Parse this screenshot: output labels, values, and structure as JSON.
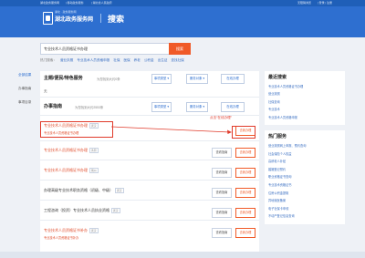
{
  "topbar": {
    "left_links": [
      "湖北政务服务网",
      "| 移动政务服务",
      "| 湖北省人民政府"
    ],
    "right_links": [
      "无障碍浏览",
      "| 登录 | 注册"
    ]
  },
  "header": {
    "logo_org": "湖北 · 政务服务网",
    "logo_title": "湖北政务服务网",
    "search_title": "搜索"
  },
  "search": {
    "value": "专业技术人员资格证书办理",
    "button": "搜索"
  },
  "hotwords": {
    "label": "热门搜索：",
    "items": [
      "营业执照",
      "专业技术人员资格申报",
      "社保",
      "医保",
      "养老",
      "公积金",
      "出生证",
      "查找社保"
    ]
  },
  "sidenav": [
    "全部结果",
    "办事指南",
    "事项目录"
  ],
  "theme_section": {
    "title": "主题/便民/特色服务",
    "meta": "为您找到大约0条",
    "filters": [
      "事项类型",
      "服务对象",
      "在线办理"
    ],
    "empty_text": "无"
  },
  "guide_section": {
    "title": "办事指南",
    "meta": "为您找到大约2553条",
    "filters": [
      "事项类型",
      "服务对象",
      "在线办理"
    ]
  },
  "services": [
    {
      "title": "专业技术人员资格证书办理",
      "tag": "武汉",
      "sub": "专业技术人员资格证书办理",
      "guide": "",
      "go": "去我办理"
    },
    {
      "title": "专业技术人员资格证书办理",
      "tag": "黄冈",
      "sub": "",
      "guide": "查看指南",
      "go": "去我办理"
    },
    {
      "title": "专业技术人员资格证书办理",
      "tag": "荆州",
      "sub": "",
      "guide": "查看指南",
      "go": "去我办理"
    },
    {
      "title": "办理高级专业技术职务资格（初级、中级）",
      "tag": "武汉",
      "sub": "",
      "guide": "查看指南",
      "go": "去我办理"
    },
    {
      "title": "工程咨询（投资）专业技术人员执业资格",
      "tag": "武汉",
      "sub": "",
      "guide": "查看指南",
      "go": "去我办理"
    },
    {
      "title": "专业技术人员资格证书补办",
      "tag": "武汉",
      "sub": "专业技术人员资格证书补办",
      "guide": "查看指南",
      "go": "去我办理"
    }
  ],
  "annotation": "点击“在线办理”",
  "right_panels": {
    "latest": {
      "title": "最近搜索",
      "items": [
        "专业技术人员资格证书办理",
        "营业执照",
        "社保查询",
        "专业技术",
        "专业技术人员资格申报"
      ]
    },
    "hot": {
      "title": "热门服务",
      "items": [
        "营业执照网上申报、预约查询",
        "社会保险个人权益",
        "高龄老人补贴",
        "婚姻登记预约",
        "职业资格证书查询",
        "专业技术资格证书",
        "住房公积金提取",
        "异地就医备案",
        "电子社保卡申领",
        "不动产登记信息查询"
      ]
    }
  }
}
